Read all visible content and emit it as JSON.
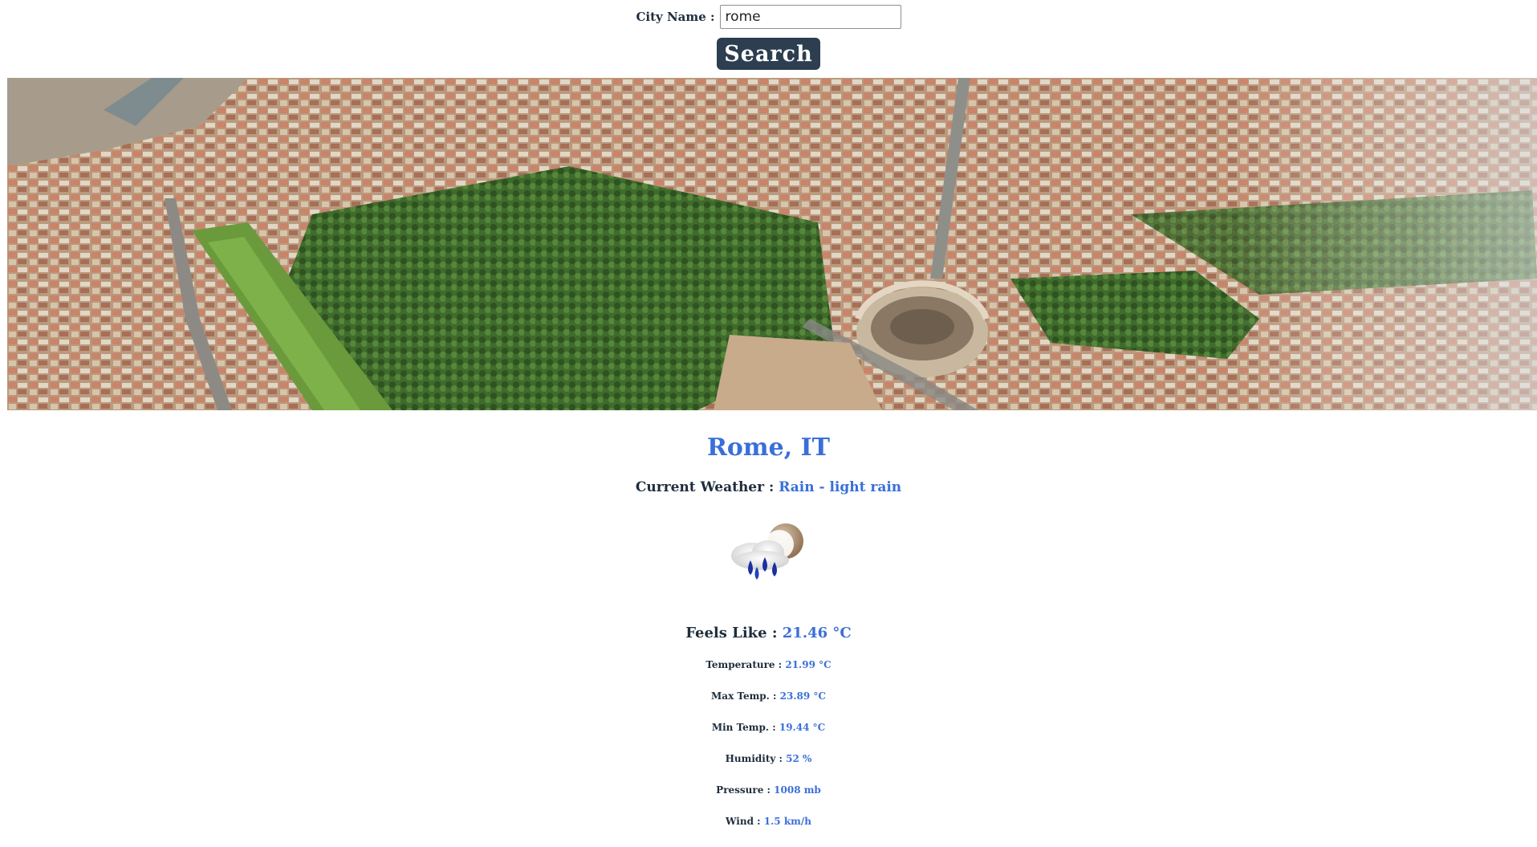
{
  "search": {
    "label": "City Name :",
    "value": "rome",
    "button_label": "Search"
  },
  "hero": {
    "image": "aerial-rome-colosseum-photo"
  },
  "weather": {
    "city": "Rome, IT",
    "current_label": "Current Weather :",
    "current_value": "Rain - light rain",
    "icon": "light-rain-night-icon",
    "feels_like_label": "Feels Like :",
    "feels_like_value": "21.46 °C",
    "stats": [
      {
        "label": "Temperature :",
        "value": "21.99 °C"
      },
      {
        "label": "Max Temp. :",
        "value": "23.89 °C"
      },
      {
        "label": "Min Temp. :",
        "value": "19.44 °C"
      },
      {
        "label": "Humidity :",
        "value": "52 %"
      },
      {
        "label": "Pressure :",
        "value": "1008 mb"
      },
      {
        "label": "Wind :",
        "value": "1.5 km/h"
      }
    ]
  },
  "colors": {
    "accent": "#3a6fd8",
    "text": "#1f2d3d",
    "button": "#2c3e50"
  }
}
